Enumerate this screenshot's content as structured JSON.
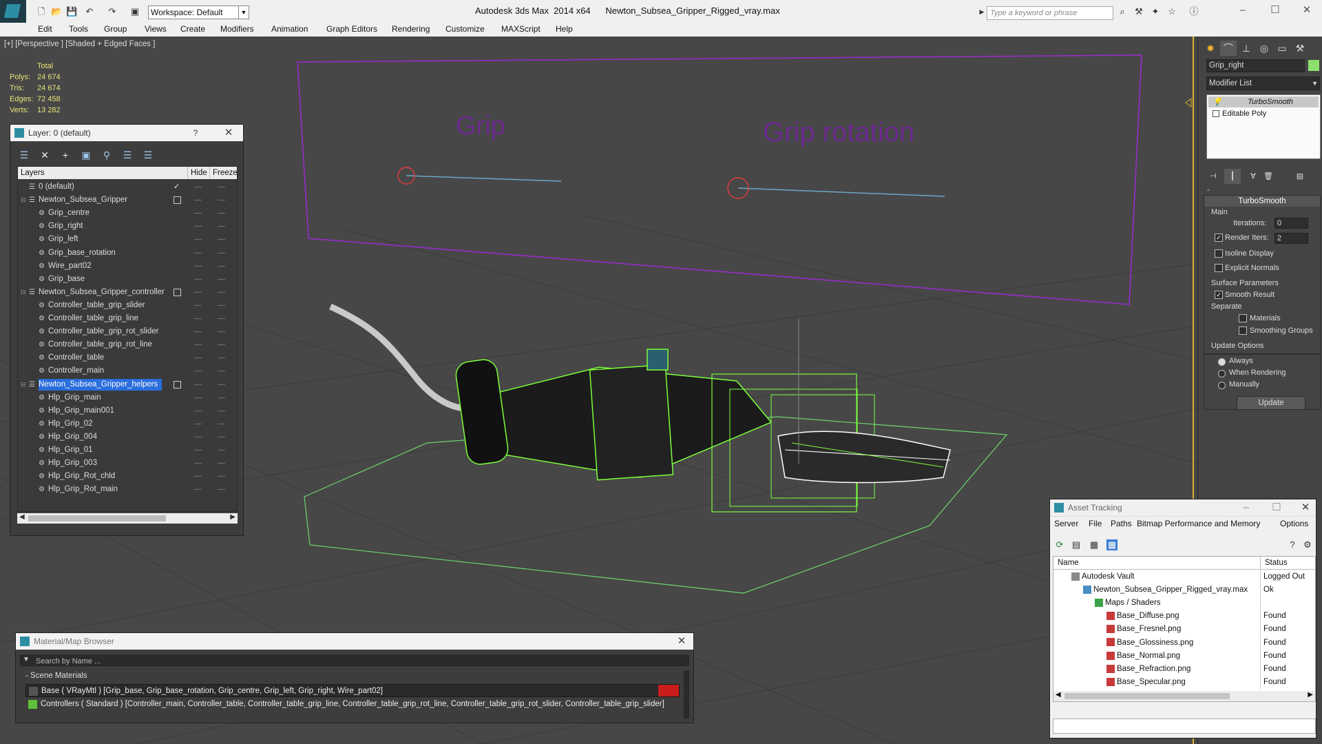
{
  "titlebar": {
    "workspace": "Workspace: Default",
    "app_title": "Autodesk 3ds Max  2014 x64      Newton_Subsea_Gripper_Rigged_vray.max",
    "search_placeholder": "Type a keyword or phrase"
  },
  "menu": [
    "Edit",
    "Tools",
    "Group",
    "Views",
    "Create",
    "Modifiers",
    "Animation",
    "Graph Editors",
    "Rendering",
    "Customize",
    "MAXScript",
    "Help"
  ],
  "viewport": {
    "label": "[+] [Perspective ] [Shaded + Edged Faces ]",
    "stats": {
      "header": "Total",
      "rows": [
        {
          "label": "Polys:",
          "value": "24 674"
        },
        {
          "label": "Tris:",
          "value": "24 674"
        },
        {
          "label": "Edges:",
          "value": "72 458"
        },
        {
          "label": "Verts:",
          "value": "13 282"
        }
      ]
    },
    "slider_labels": [
      "Grip",
      "Grip rotation"
    ],
    "colors": {
      "background": "#474747",
      "selection": "#7cff3c",
      "controller": "#9b2bd1"
    }
  },
  "layer_explorer": {
    "title": "Layer: 0 (default)",
    "help": "?",
    "columns": [
      "Layers",
      "Hide",
      "Freeze"
    ],
    "rows": [
      {
        "name": "0 (default)",
        "level": 0,
        "type": "layer",
        "current": true
      },
      {
        "name": "Newton_Subsea_Gripper",
        "level": 0,
        "type": "layer"
      },
      {
        "name": "Grip_centre",
        "level": 1,
        "type": "object"
      },
      {
        "name": "Grip_right",
        "level": 1,
        "type": "object"
      },
      {
        "name": "Grip_left",
        "level": 1,
        "type": "object"
      },
      {
        "name": "Grip_base_rotation",
        "level": 1,
        "type": "object"
      },
      {
        "name": "Wire_part02",
        "level": 1,
        "type": "object"
      },
      {
        "name": "Grip_base",
        "level": 1,
        "type": "object"
      },
      {
        "name": "Newton_Subsea_Gripper_controller",
        "level": 0,
        "type": "layer"
      },
      {
        "name": "Controller_table_grip_slider",
        "level": 1,
        "type": "object"
      },
      {
        "name": "Controller_table_grip_line",
        "level": 1,
        "type": "object"
      },
      {
        "name": "Controller_table_grip_rot_slider",
        "level": 1,
        "type": "object"
      },
      {
        "name": "Controller_table_grip_rot_line",
        "level": 1,
        "type": "object"
      },
      {
        "name": "Controller_table",
        "level": 1,
        "type": "object"
      },
      {
        "name": "Controller_main",
        "level": 1,
        "type": "object"
      },
      {
        "name": "Newton_Subsea_Gripper_helpers",
        "level": 0,
        "type": "layer",
        "selected": true
      },
      {
        "name": "Hlp_Grip_main",
        "level": 1,
        "type": "object"
      },
      {
        "name": "Hlp_Grip_main001",
        "level": 1,
        "type": "object"
      },
      {
        "name": "Hlp_Grip_02",
        "level": 1,
        "type": "object"
      },
      {
        "name": "Hlp_Grip_004",
        "level": 1,
        "type": "object"
      },
      {
        "name": "Hlp_Grip_01",
        "level": 1,
        "type": "object"
      },
      {
        "name": "Hlp_Grip_003",
        "level": 1,
        "type": "object"
      },
      {
        "name": "Hlp_Grip_Rot_chld",
        "level": 1,
        "type": "object"
      },
      {
        "name": "Hlp_Grip_Rot_main",
        "level": 1,
        "type": "object"
      }
    ]
  },
  "command_panel": {
    "object_name": "Grip_right",
    "object_color": "#8ee06d",
    "modifier_list": "Modifier List",
    "stack": [
      "TurboSmooth",
      "Editable Poly"
    ],
    "turbosmooth": {
      "title": "TurboSmooth",
      "main": "Main",
      "iterations_label": "Iterations:",
      "iterations": "0",
      "render_iters_label": "Render Iters:",
      "render_iters": "2",
      "isoline": "Isoline Display",
      "explicit_normals": "Explicit Normals",
      "surface_params": "Surface Parameters",
      "smooth_result": "Smooth Result",
      "separate": "Separate",
      "materials": "Materials",
      "smoothing_groups": "Smoothing Groups",
      "update_options": "Update Options",
      "always": "Always",
      "when_rendering": "When Rendering",
      "manually": "Manually",
      "update": "Update"
    }
  },
  "asset_tracking": {
    "title": "Asset Tracking",
    "menu": [
      "Server",
      "File",
      "Paths",
      "Bitmap Performance and Memory",
      "Options"
    ],
    "columns": [
      "Name",
      "Status"
    ],
    "rows": [
      {
        "name": "Autodesk Vault",
        "status": "Logged Out",
        "level": 0,
        "icon": "vault-icon"
      },
      {
        "name": "Newton_Subsea_Gripper_Rigged_vray.max",
        "status": "Ok",
        "level": 1,
        "icon": "max-file-icon"
      },
      {
        "name": "Maps / Shaders",
        "status": "",
        "level": 2,
        "icon": "maps-folder-icon"
      },
      {
        "name": "Base_Diffuse.png",
        "status": "Found",
        "level": 3,
        "icon": "png-icon"
      },
      {
        "name": "Base_Fresnel.png",
        "status": "Found",
        "level": 3,
        "icon": "png-icon"
      },
      {
        "name": "Base_Glossiness.png",
        "status": "Found",
        "level": 3,
        "icon": "png-icon"
      },
      {
        "name": "Base_Normal.png",
        "status": "Found",
        "level": 3,
        "icon": "png-icon"
      },
      {
        "name": "Base_Refraction.png",
        "status": "Found",
        "level": 3,
        "icon": "png-icon"
      },
      {
        "name": "Base_Specular.png",
        "status": "Found",
        "level": 3,
        "icon": "png-icon"
      }
    ]
  },
  "material_browser": {
    "title": "Material/Map Browser",
    "search_placeholder": "Search by Name ...",
    "section": "- Scene Materials",
    "rows": [
      "Base ( VRayMtl ) [Grip_base, Grip_base_rotation, Grip_centre, Grip_left, Grip_right, Wire_part02]",
      "Controllers ( Standard ) [Controller_main, Controller_table, Controller_table_grip_line, Controller_table_grip_rot_line, Controller_table_grip_rot_slider, Controller_table_grip_slider]"
    ]
  }
}
